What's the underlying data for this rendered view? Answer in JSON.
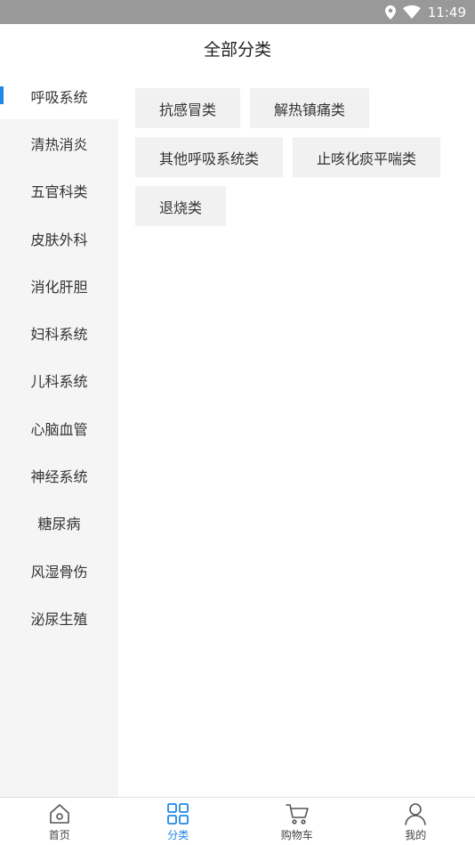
{
  "status_bar": {
    "time": "11:49"
  },
  "header": {
    "title": "全部分类"
  },
  "sidebar": {
    "items": [
      {
        "label": "呼吸系统",
        "active": true
      },
      {
        "label": "清热消炎"
      },
      {
        "label": "五官科类"
      },
      {
        "label": "皮肤外科"
      },
      {
        "label": "消化肝胆"
      },
      {
        "label": "妇科系统"
      },
      {
        "label": "儿科系统"
      },
      {
        "label": "心脑血管"
      },
      {
        "label": "神经系统"
      },
      {
        "label": "糖尿病"
      },
      {
        "label": "风湿骨伤"
      },
      {
        "label": "泌尿生殖"
      }
    ]
  },
  "subcategories": [
    {
      "label": "抗感冒类"
    },
    {
      "label": "解热镇痛类"
    },
    {
      "label": "其他呼吸系统类"
    },
    {
      "label": "止咳化痰平喘类"
    },
    {
      "label": "退烧类"
    }
  ],
  "tabbar": {
    "items": [
      {
        "label": "首页",
        "icon": "home-icon"
      },
      {
        "label": "分类",
        "icon": "category-icon",
        "active": true
      },
      {
        "label": "购物车",
        "icon": "cart-icon"
      },
      {
        "label": "我的",
        "icon": "user-icon"
      }
    ]
  },
  "colors": {
    "accent": "#1e88e5",
    "status_bar": "#999999",
    "sidebar_bg": "#f5f5f5",
    "tag_bg": "#f1f1f1"
  }
}
